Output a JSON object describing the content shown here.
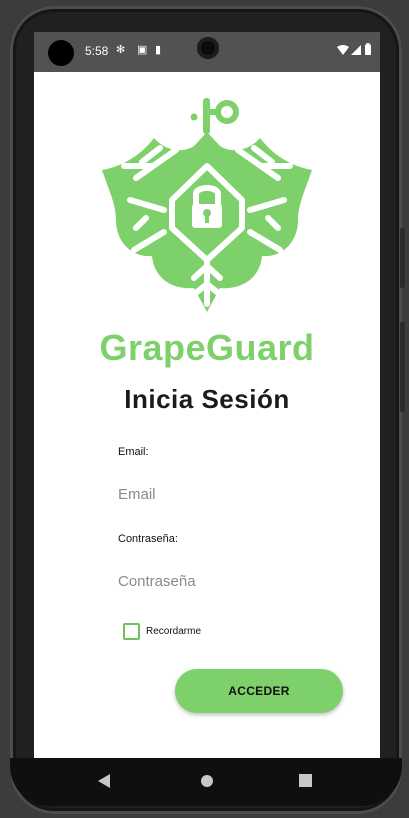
{
  "status_bar": {
    "time": "5:58",
    "icons": [
      "gear-icon",
      "square-notification-icon",
      "sd-card-icon"
    ],
    "right_icons": [
      "wifi-icon",
      "signal-icon",
      "battery-icon"
    ]
  },
  "app": {
    "brand_name": "GrapeGuard",
    "brand_color": "#7ed16a",
    "logo_icon": "grape-leaf-lock-logo",
    "heading": "Inicia Sesión"
  },
  "form": {
    "email_label": "Email:",
    "email_value": "",
    "email_placeholder": "Email",
    "password_label": "Contraseña:",
    "password_value": "",
    "password_placeholder": "Contraseña",
    "remember_label": "Recordarme",
    "remember_checked": false,
    "submit_label": "ACCEDER"
  },
  "nav_bar": {
    "buttons": [
      "back-triangle-icon",
      "home-circle-icon",
      "recents-square-icon"
    ]
  }
}
